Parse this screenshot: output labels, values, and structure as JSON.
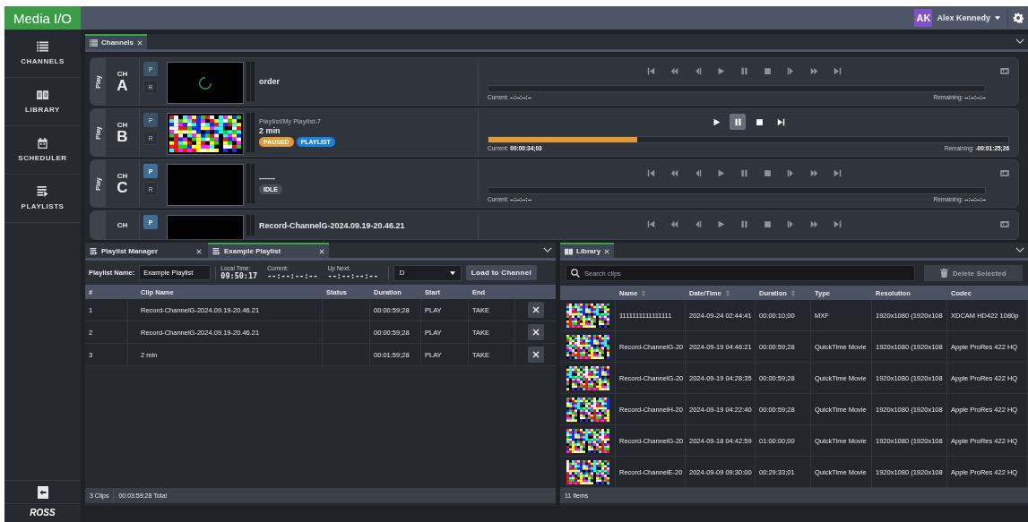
{
  "app": {
    "logo": "Media I/O",
    "user": {
      "initials": "AK",
      "name": "Alex Kennedy"
    }
  },
  "sidebar": {
    "items": [
      {
        "label": "CHANNELS",
        "kind": "channels"
      },
      {
        "label": "LIBRARY",
        "kind": "library"
      },
      {
        "label": "SCHEDULER",
        "kind": "scheduler"
      },
      {
        "label": "PLAYLISTS",
        "kind": "playlists"
      }
    ],
    "brand": "ROSS"
  },
  "channels_panel": {
    "tab": {
      "label": "Channels",
      "selected": true
    },
    "channels": [
      {
        "mode_label": "Play",
        "prefix": "CH",
        "letter": "A",
        "p_label": "P",
        "r_label": "R",
        "p_active": false,
        "preview": {
          "kind": "loading"
        },
        "title": "order",
        "transport": {
          "kind": "full",
          "paused": false
        },
        "level": 0,
        "current_label": "Current:",
        "current": "--:--:--:--",
        "remaining_label": "Remaining:",
        "remaining": "--:--:--:--",
        "cue": true
      },
      {
        "mode_label": "Play",
        "prefix": "CH",
        "letter": "B",
        "p_label": "P",
        "r_label": "R",
        "p_active": false,
        "preview": {
          "kind": "noise"
        },
        "subtitle": "Playlist/My Playlist-7",
        "title": "2 min",
        "badges": [
          {
            "label": "PAUSED",
            "color": "#e39a34"
          },
          {
            "label": "PLAYLIST",
            "color": "#1b7fe3"
          }
        ],
        "transport": {
          "kind": "compact",
          "paused": true
        },
        "level": 0.286,
        "current_label": "Current:",
        "current": "00:00:34;03",
        "remaining_label": "Remaining:",
        "remaining": "-00:01:25;26",
        "cue": false
      },
      {
        "mode_label": "Play",
        "prefix": "CH",
        "letter": "C",
        "p_label": "P",
        "r_label": "R",
        "p_active": true,
        "preview": {
          "kind": "blank"
        },
        "title": "------",
        "badges": [
          {
            "label": "IDLE",
            "color": "#4a505b"
          }
        ],
        "transport": {
          "kind": "full",
          "paused": false
        },
        "level": 0,
        "current_label": "Current:",
        "current": "--:--:--:--",
        "remaining_label": "Remaining:",
        "remaining": "--:--:--:--",
        "cue": true
      },
      {
        "prefix": "CH",
        "p_label": "P",
        "p_active": true,
        "preview": {
          "kind": "blank"
        },
        "title": "Record-ChannelG-2024.09.19-20.46.21",
        "transport": {
          "kind": "full",
          "paused": false
        },
        "cue": true
      }
    ]
  },
  "playlist_panel": {
    "tabs": [
      {
        "label": "Playlist Manager",
        "selected": false
      },
      {
        "label": "Example Playlist",
        "selected": true
      }
    ],
    "name_label": "Playlist Name:",
    "name_value": "Example Playlist",
    "local_time_label": "Local Time:",
    "local_time": "09:50:17",
    "current_label": "Current:",
    "current": "--:--:--:--",
    "up_next_label": "Up Next:",
    "up_next": "--:--:--:--",
    "channel_select": "D",
    "load_button": "Load to Channel",
    "columns": [
      "#",
      "Clip Name",
      "Status",
      "Duration",
      "Start",
      "End"
    ],
    "rows": [
      {
        "index": "1",
        "clip_name": "Record-ChannelG-2024.09.19-20.46.21",
        "duration": "00:00:59;28",
        "start": "PLAY",
        "end": "TAKE"
      },
      {
        "index": "2",
        "clip_name": "Record-ChannelG-2024.09.19-20.46.21",
        "duration": "00:00:59;28",
        "start": "PLAY",
        "end": "TAKE"
      },
      {
        "index": "3",
        "clip_name": "2 min",
        "duration": "00:01:59;28",
        "start": "PLAY",
        "end": "TAKE"
      }
    ],
    "clip_count": "3 Clips",
    "total": "00:03:59;28 Total"
  },
  "library_panel": {
    "tab": {
      "label": "Library",
      "selected": true
    },
    "search_placeholder": "Search clips",
    "delete_button": {
      "label": "Delete Selected",
      "disabled": true
    },
    "columns": [
      {
        "label": "Name",
        "sortable": true
      },
      {
        "label": "Date/Time",
        "sortable": true
      },
      {
        "label": "Duration",
        "sortable": true
      },
      {
        "label": "Type",
        "sortable": false
      },
      {
        "label": "Resolution",
        "sortable": false
      },
      {
        "label": "Codec",
        "sortable": false
      }
    ],
    "rows": [
      {
        "name": "1111111111111111",
        "datetime": "2024-09-24 02:44:41",
        "duration": "00:00:10;00",
        "type": "MXF",
        "resolution": "1920x1080 (1920x108",
        "codec": "XDCAM HD422 1080p"
      },
      {
        "name": "Record-ChannelG-20",
        "datetime": "2024-09-19 04:46:21",
        "duration": "00:00:59;28",
        "type": "QuickTime Movie",
        "resolution": "1920x1080 (1920x108",
        "codec": "Apple ProRes 422 HQ"
      },
      {
        "name": "Record-ChannelG-20",
        "datetime": "2024-09-19 04:28:35",
        "duration": "00:00:59;28",
        "type": "QuickTime Movie",
        "resolution": "1920x1080 (1920x108",
        "codec": "Apple ProRes 422 HQ"
      },
      {
        "name": "Record-ChannelH-20",
        "datetime": "2024-09-19 04:22:40",
        "duration": "00:00:59;28",
        "type": "QuickTime Movie",
        "resolution": "1920x1080 (1920x108",
        "codec": "Apple ProRes 422 HQ"
      },
      {
        "name": "Record-ChannelG-20",
        "datetime": "2024-09-18 04:42:59",
        "duration": "01:00:00;00",
        "type": "QuickTime Movie",
        "resolution": "1920x1080 (1920x108",
        "codec": "Apple ProRes 422 HQ"
      },
      {
        "name": "Record-ChannelE-20",
        "datetime": "2024-09-09 09:30:00",
        "duration": "00:29:33;01",
        "type": "QuickTime Movie",
        "resolution": "1920x1080 (1920x108",
        "codec": "Apple ProRes 422 HQ"
      }
    ],
    "footer": "11 Items"
  }
}
